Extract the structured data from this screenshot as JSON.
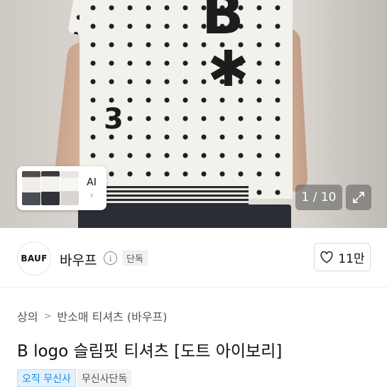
{
  "hero": {
    "shirt_print_letter": "B",
    "shirt_print_star": "✱",
    "shirt_print_number": "3",
    "ai_label": "AI",
    "ai_chevron": "›",
    "image_counter": "1 / 10",
    "expand_icon": "expand-icon"
  },
  "brand": {
    "logo_text": "BAUF",
    "name": "바우프",
    "info_icon": "i",
    "exclusive_tag": "단독",
    "like_count": "11만",
    "heart_icon": "heart-outline-icon"
  },
  "breadcrumb": {
    "items": [
      "상의",
      "반소매 티셔츠 (바우프)"
    ],
    "separator": ">"
  },
  "product": {
    "title": "B logo 슬림핏 티셔츠 [도트 아이보리]",
    "tags": [
      {
        "label": "오직 무신사",
        "style": "blue"
      },
      {
        "label": "무신사단독",
        "style": "gray"
      }
    ]
  },
  "colors": {
    "accent_blue": "#1a8ee1",
    "tag_blue_bg": "#e3f1fd"
  }
}
